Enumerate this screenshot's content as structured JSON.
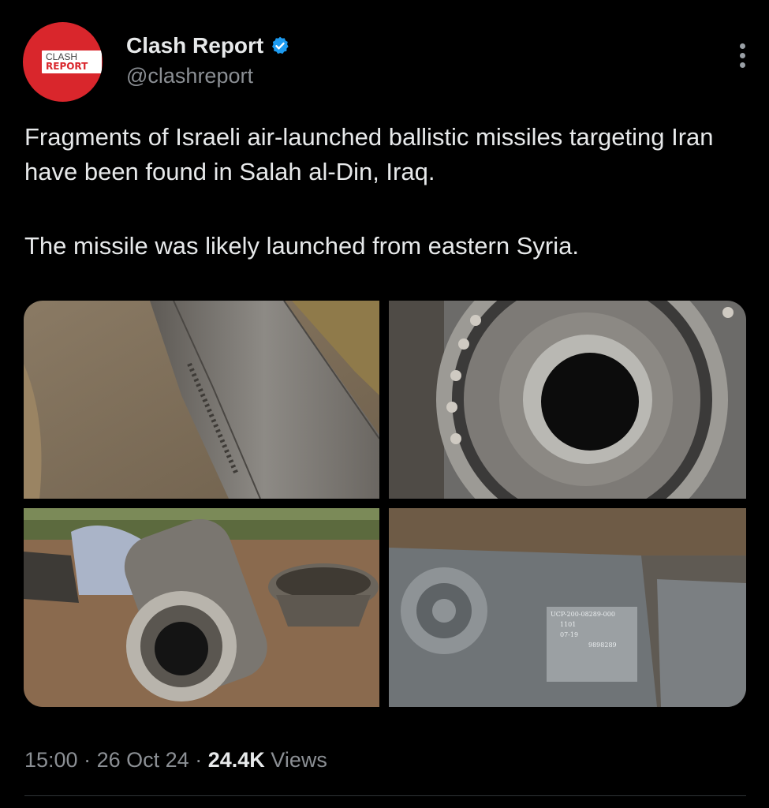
{
  "tweet": {
    "author": {
      "display_name": "Clash Report",
      "handle": "@clashreport",
      "verified": true,
      "avatar_text_top": "CLASH",
      "avatar_text_bottom": "REPORT",
      "avatar_color": "#d9262c"
    },
    "text_paragraphs": [
      "Fragments of Israeli air-launched ballistic missiles targeting Iran have been found in Salah al-Din, Iraq.",
      "The missile was likely launched from eastern Syria."
    ],
    "media": {
      "photos": [
        {
          "label": "missile-fragment-on-ground"
        },
        {
          "label": "missile-engine-nozzle-closeup"
        },
        {
          "label": "missile-pieces-in-field"
        },
        {
          "label": "missile-part-with-serial-plate",
          "plate_lines": [
            "UCP-200-08289-000",
            "1101",
            "07-19",
            "9898289"
          ]
        }
      ]
    },
    "meta": {
      "time": "15:00",
      "separator": "·",
      "date": "26 Oct 24",
      "views_count": "24.4K",
      "views_label": "Views"
    },
    "icons": {
      "verified_badge": "verified-badge-icon",
      "more": "more-vertical-icon"
    },
    "colors": {
      "background": "#000000",
      "text": "#e7e9ea",
      "secondary": "#8b8f94",
      "verified": "#1d9bf0"
    }
  }
}
